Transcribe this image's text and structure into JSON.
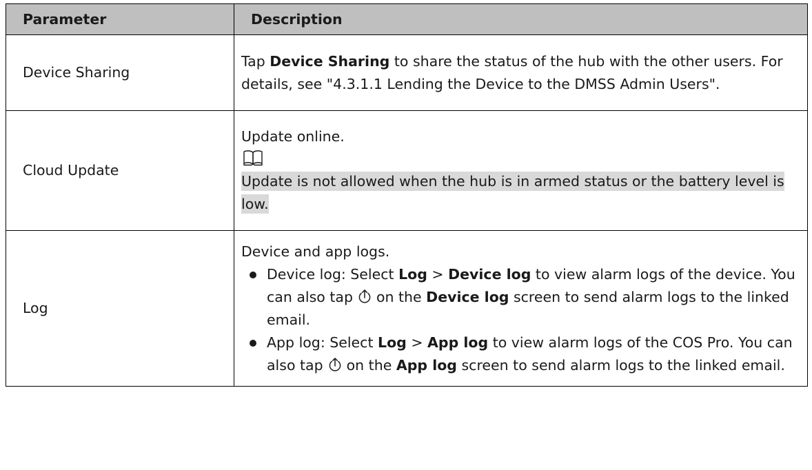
{
  "table": {
    "headers": {
      "parameter": "Parameter",
      "description": "Description"
    },
    "rows": {
      "device_sharing": {
        "param": "Device Sharing",
        "desc": {
          "t1": "Tap ",
          "b1": "Device Sharing",
          "t2": " to share the status of the hub with the other users. For details, see \"4.3.1.1 Lending the Device to the DMSS Admin Users\"."
        }
      },
      "cloud_update": {
        "param": "Cloud Update",
        "desc": {
          "text": "Update online.",
          "note_icon": "book-icon",
          "note": "Update is not allowed when the hub is in armed status or the battery level is low."
        }
      },
      "log": {
        "param": "Log",
        "desc": {
          "intro": "Device and app logs.",
          "bullets": [
            {
              "t1": "Device log: Select ",
              "b1": "Log",
              "t2": " > ",
              "b2": "Device log",
              "t3": " to view alarm logs of the device. You can also tap",
              "icon": "upload-icon",
              "t4": "on the ",
              "b3": "Device log",
              "t5": " screen to send alarm logs to the linked email."
            },
            {
              "t1": "App log: Select ",
              "b1": "Log",
              "t2": " > ",
              "b2": "App log",
              "t3": " to view alarm logs of the COS Pro. You can also tap",
              "icon": "upload-icon",
              "t4": "on the ",
              "b3": "App log",
              "t5": " screen to send alarm logs to the linked email."
            }
          ]
        }
      }
    }
  }
}
